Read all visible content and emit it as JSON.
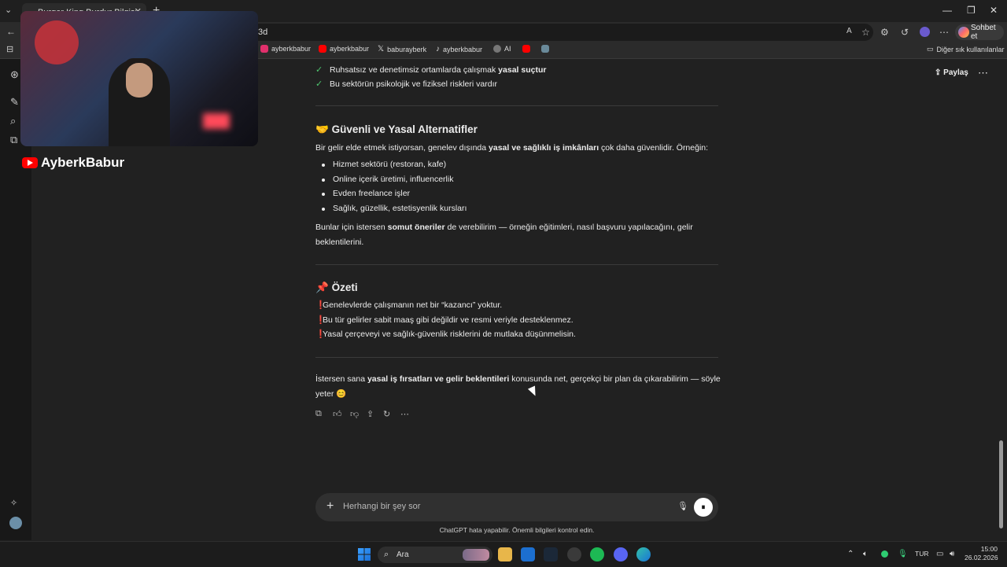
{
  "browser": {
    "tab_title": "Burger King Burdur Bilgisi",
    "address_text": "3d",
    "chat_button": "Sohbet et",
    "bookmarks": [
      {
        "label": "ayberkbabur",
        "icon": "instagram-icon",
        "color": "#e1306c"
      },
      {
        "label": "ayberkbabur",
        "icon": "youtube-icon",
        "color": "#ff0000"
      },
      {
        "label": "baburayberk",
        "icon": "x-icon",
        "color": "#ffffff"
      },
      {
        "label": "ayberkbabur",
        "icon": "tiktok-icon",
        "color": "#ffffff"
      },
      {
        "label": "AI",
        "icon": "chatgpt-icon",
        "color": "#cccccc"
      }
    ],
    "other_bookmarks": "Diğer sık kullanılanlar"
  },
  "overlay": {
    "channel_name": "AyberkBabur"
  },
  "header": {
    "share_label": "Paylaş"
  },
  "message": {
    "checks": [
      {
        "text_before": "Ruhsatsız ve denetimsiz ortamlarda çalışmak ",
        "bold": "yasal suçtur",
        "text_after": ""
      },
      {
        "text_before": "Bu sektörün psikolojik ve fiziksel riskleri vardır",
        "bold": "",
        "text_after": ""
      }
    ],
    "section1": {
      "emoji": "🤝",
      "title": "Güvenli ve Yasal Alternatifler",
      "intro_before": "Bir gelir elde etmek istiyorsan, genelev dışında ",
      "intro_bold": "yasal ve sağlıklı iş imkânları",
      "intro_after": " çok daha güvenlidir. Örneğin:",
      "bullets": [
        "Hizmet sektörü (restoran, kafe)",
        "Online içerik üretimi, influencerlik",
        "Evden freelance işler",
        "Sağlık, güzellik, estetisyenlik kursları"
      ],
      "outro_before": "Bunlar için istersen ",
      "outro_bold": "somut öneriler",
      "outro_after": " de verebilirim — örneğin eğitimleri, nasıl başvuru yapılacağını, gelir",
      "outro_line2": "beklentilerini."
    },
    "section2": {
      "emoji": "📌",
      "title": "Özeti",
      "mark": "❗",
      "items": [
        "Genelevlerde çalışmanın net bir “kazancı” yoktur.",
        "Bu tür gelirler sabit maaş gibi değildir ve resmi veriyle desteklenmez.",
        "Yasal çerçeveyi ve sağlık-güvenlik risklerini de mutlaka düşünmelisin."
      ]
    },
    "closing_before": "İstersen sana ",
    "closing_bold": "yasal iş fırsatları ve gelir beklentileri",
    "closing_after": " konusunda net, gerçekçi bir plan da çıkarabilirim — söyle",
    "closing_line2": "yeter 😊"
  },
  "composer": {
    "placeholder": "Herhangi bir şey sor"
  },
  "disclaimer": "ChatGPT hata yapabilir. Önemli bilgileri kontrol edin.",
  "taskbar": {
    "search_label": "Ara",
    "language": "TUR",
    "time": "15:00",
    "date": "26.02.2026"
  }
}
